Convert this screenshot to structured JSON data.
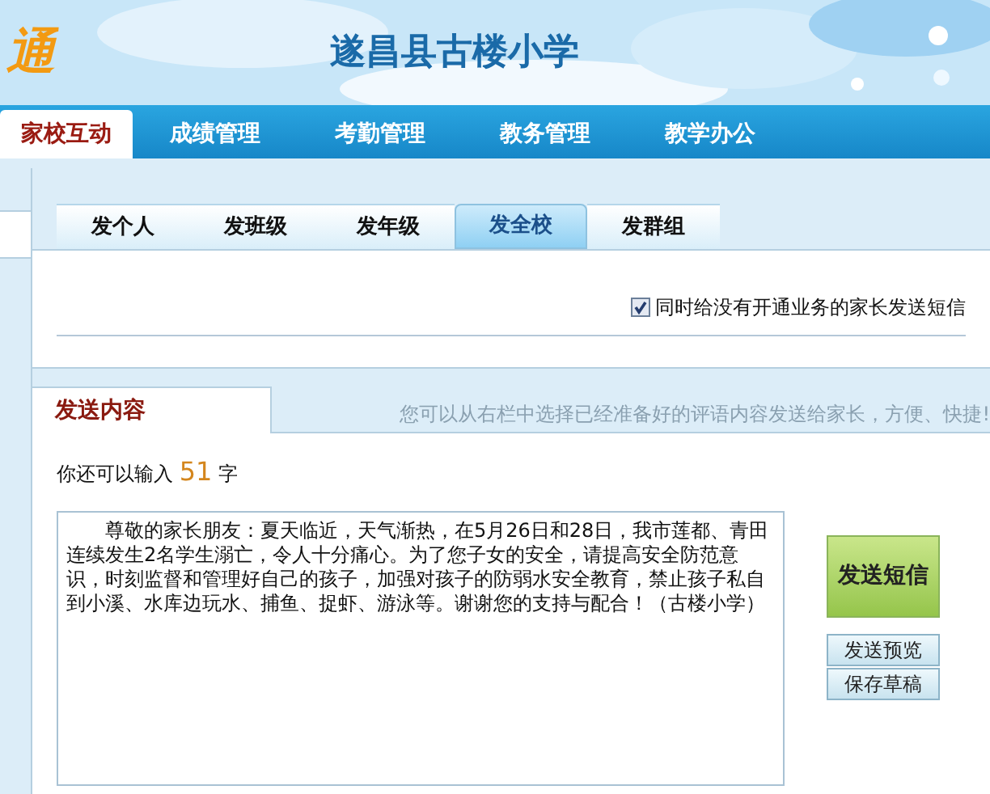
{
  "header": {
    "logo": "通",
    "school": "遂昌县古楼小学"
  },
  "nav": [
    {
      "label": "家校互动",
      "selected": true
    },
    {
      "label": "成绩管理",
      "selected": false
    },
    {
      "label": "考勤管理",
      "selected": false
    },
    {
      "label": "教务管理",
      "selected": false
    },
    {
      "label": "教学办公",
      "selected": false
    }
  ],
  "send_tabs": [
    {
      "label": "发个人",
      "selected": false
    },
    {
      "label": "发班级",
      "selected": false
    },
    {
      "label": "发年级",
      "selected": false
    },
    {
      "label": "发全校",
      "selected": true
    },
    {
      "label": "发群组",
      "selected": false
    }
  ],
  "sms_option": {
    "label": "同时给没有开通业务的家长发送短信",
    "checked": true
  },
  "content": {
    "tab": "发送内容",
    "hint": "您可以从右栏中选择已经准备好的评语内容发送给家长，方便、快捷!",
    "remaining_prefix": "你还可以输入",
    "remaining_count": "51",
    "remaining_suffix": "字",
    "message": "尊敬的家长朋友：夏天临近，天气渐热，在5月26日和28日，我市莲都、青田连续发生2名学生溺亡，令人十分痛心。为了您子女的安全，请提高安全防范意识，时刻监督和管理好自己的孩子，加强对孩子的防弱水安全教育，禁止孩子私自到小溪、水库边玩水、捕鱼、捉虾、游泳等。谢谢您的支持与配合！（古楼小学）"
  },
  "buttons": {
    "send": "发送短信",
    "preview": "发送预览",
    "save_draft": "保存草稿"
  }
}
